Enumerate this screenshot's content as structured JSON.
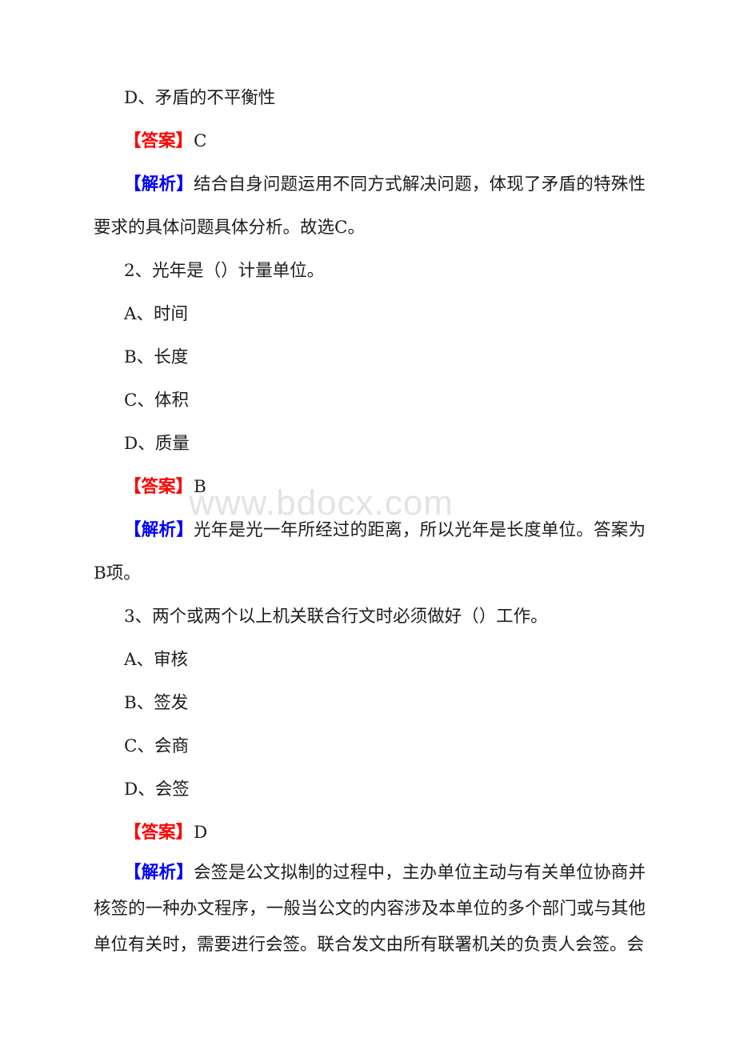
{
  "page": {
    "background_color": "#ffffff",
    "text_color": "#1d1d1d",
    "answer_label_color": "#ff0000",
    "analysis_label_color": "#0000ff"
  },
  "watermark": {
    "text": "www.bdocx.com",
    "color": "#e3e3e3"
  },
  "labels": {
    "answer": "【答案】",
    "analysis": "【解析】"
  },
  "blocks": {
    "q1_option_d": "D、矛盾的不平衡性",
    "q1_answer_value": "C",
    "q1_analysis_text": "结合自身问题运用不同方式解决问题，体现了矛盾的特殊性要求的具体问题具体分析。故选C。",
    "q2_stem": "2、光年是（）计量单位。",
    "q2_option_a": "A、时间",
    "q2_option_b": "B、长度",
    "q2_option_c": "C、体积",
    "q2_option_d": "D、质量",
    "q2_answer_value": "B",
    "q2_analysis_text": "光年是光一年所经过的距离，所以光年是长度单位。答案为B项。",
    "q3_stem": "3、两个或两个以上机关联合行文时必须做好（）工作。",
    "q3_option_a": "A、审核",
    "q3_option_b": "B、签发",
    "q3_option_c": "C、会商",
    "q3_option_d": "D、会签",
    "q3_answer_value": "D",
    "q3_analysis_text": "会签是公文拟制的过程中，主办单位主动与有关单位协商并核签的一种办文程序，一般当公文的内容涉及本单位的多个部门或与其他单位有关时，需要进行会签。联合发文由所有联署机关的负责人会签。会"
  }
}
